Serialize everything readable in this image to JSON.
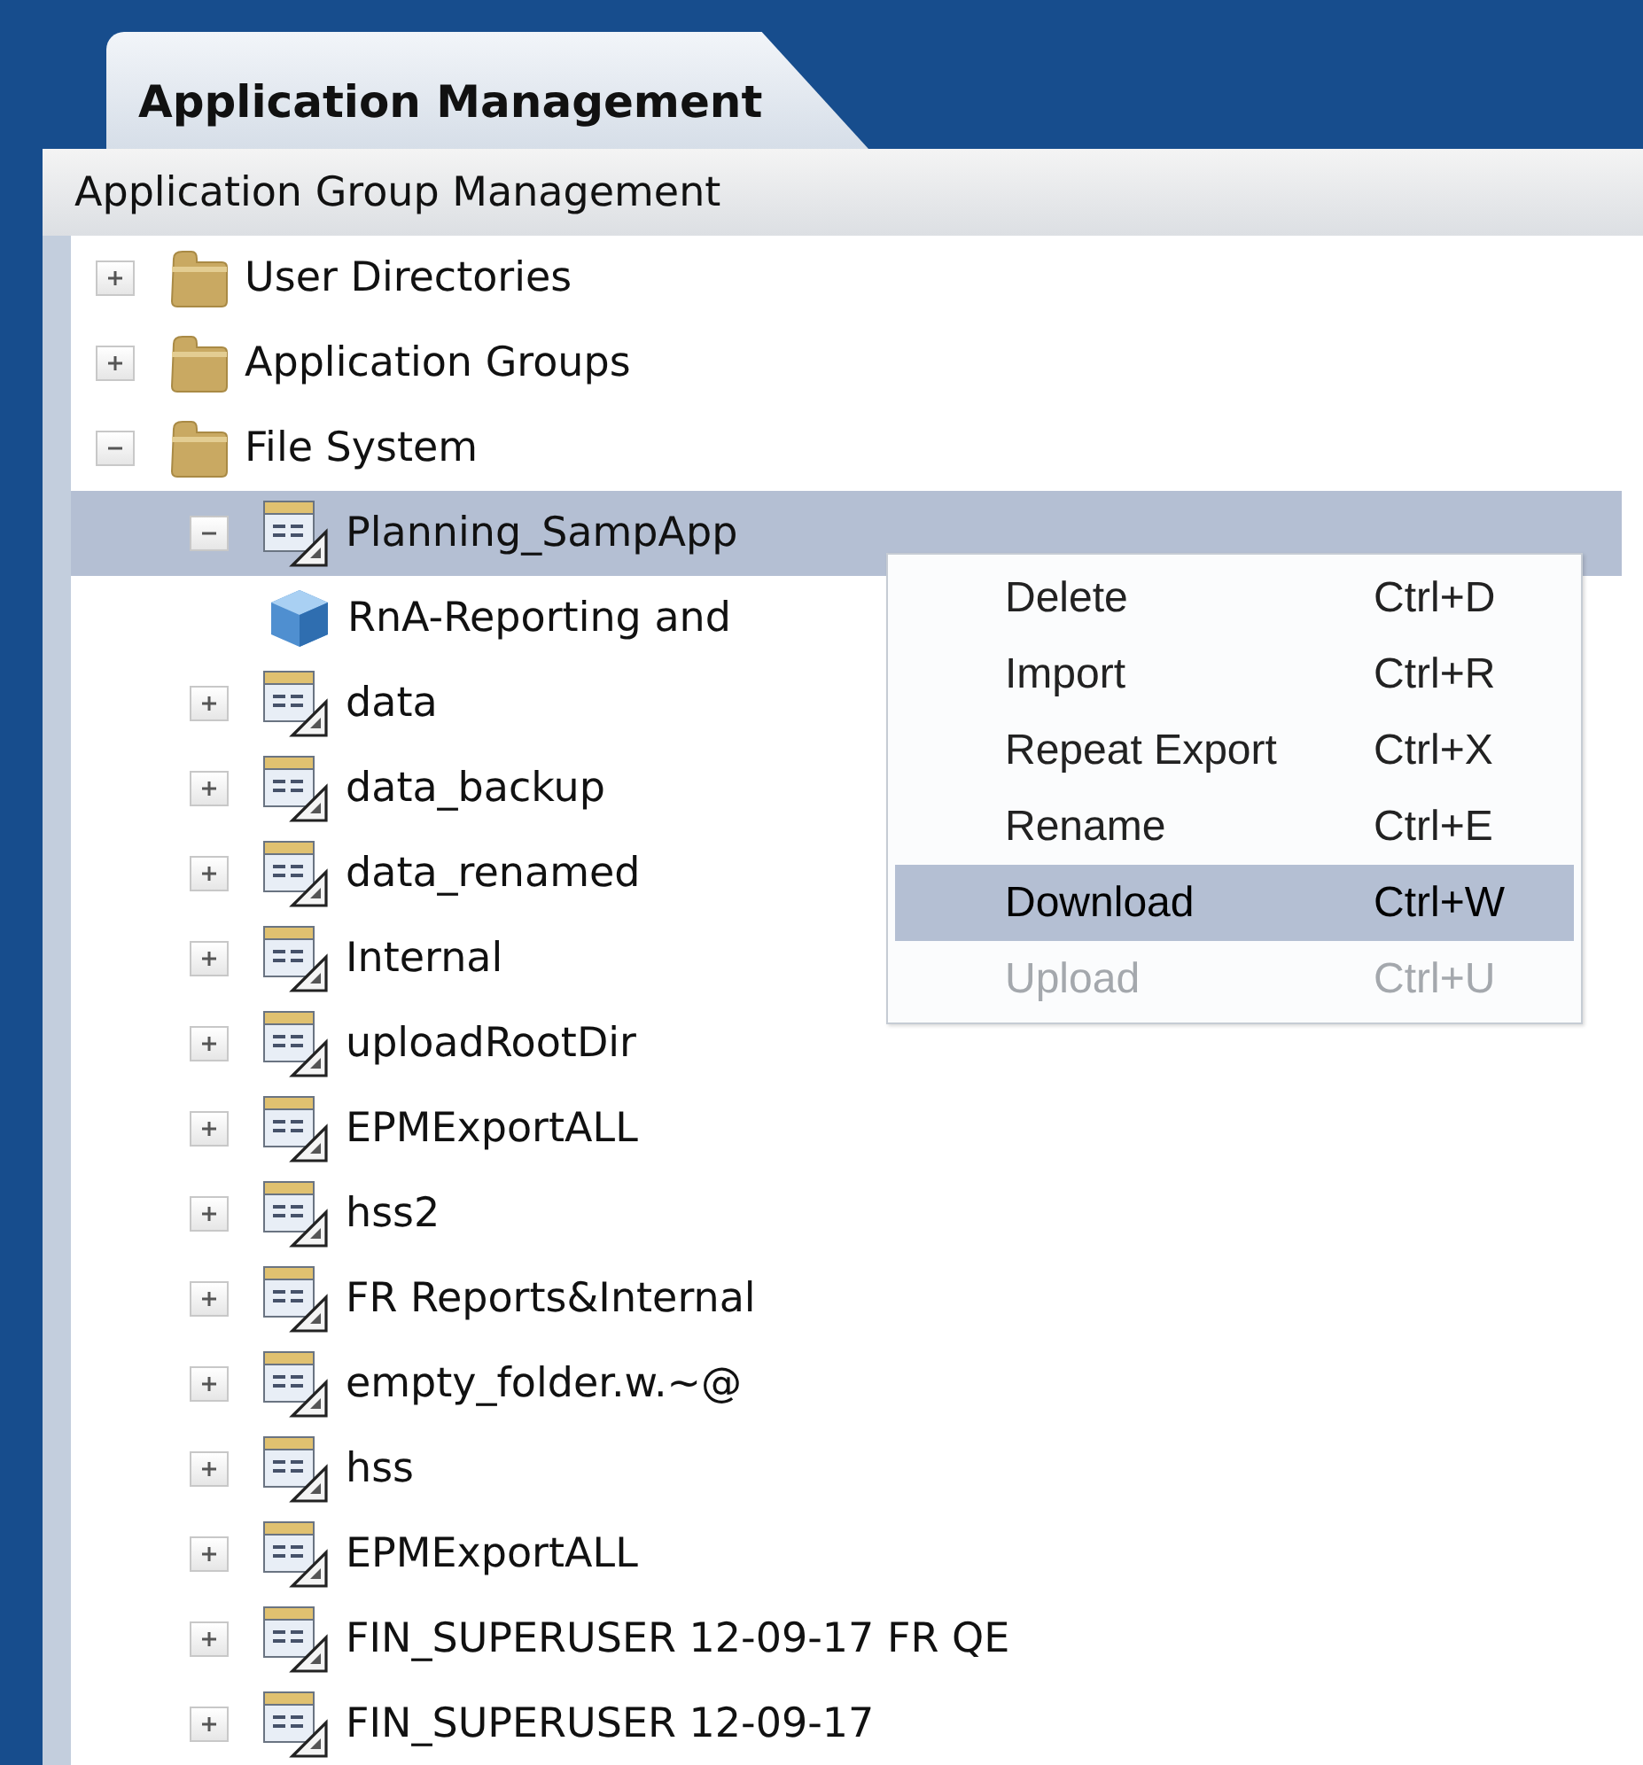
{
  "tab": {
    "label": "Application Management",
    "selected": true
  },
  "panel": {
    "title": "Application Group Management"
  },
  "tree": [
    {
      "label": "User Directories",
      "kind": "folder",
      "expanded": false,
      "selected": false
    },
    {
      "label": "Application Groups",
      "kind": "folder",
      "expanded": false,
      "selected": false
    },
    {
      "label": "File System",
      "kind": "folder",
      "expanded": true,
      "selected": false,
      "children": [
        {
          "label": "Planning_SampApp",
          "kind": "file-system",
          "expanded": true,
          "selected": true,
          "children": [
            {
              "label": "RnA-Reporting and",
              "kind": "application",
              "selected": false
            }
          ]
        },
        {
          "label": "data",
          "kind": "file-system",
          "expanded": false,
          "selected": false
        },
        {
          "label": "data_backup",
          "kind": "file-system",
          "expanded": false,
          "selected": false
        },
        {
          "label": "data_renamed",
          "kind": "file-system",
          "expanded": false,
          "selected": false
        },
        {
          "label": "Internal",
          "kind": "file-system",
          "expanded": false,
          "selected": false
        },
        {
          "label": "uploadRootDir",
          "kind": "file-system",
          "expanded": false,
          "selected": false
        },
        {
          "label": "EPMExportALL",
          "kind": "file-system",
          "expanded": false,
          "selected": false
        },
        {
          "label": "hss2",
          "kind": "file-system",
          "expanded": false,
          "selected": false
        },
        {
          "label": "FR Reports&Internal",
          "kind": "file-system",
          "expanded": false,
          "selected": false
        },
        {
          "label": "empty_folder.w.~@",
          "kind": "file-system",
          "expanded": false,
          "selected": false
        },
        {
          "label": "hss",
          "kind": "file-system",
          "expanded": false,
          "selected": false
        },
        {
          "label": "EPMExportALL",
          "kind": "file-system",
          "expanded": false,
          "selected": false
        },
        {
          "label": "FIN_SUPERUSER 12-09-17 FR QE",
          "kind": "file-system",
          "expanded": false,
          "selected": false
        },
        {
          "label": "FIN_SUPERUSER 12-09-17",
          "kind": "file-system",
          "expanded": false,
          "selected": false
        }
      ]
    }
  ],
  "context_menu": [
    {
      "label": "Delete",
      "shortcut": "Ctrl+D",
      "selected": false,
      "disabled": false
    },
    {
      "label": "Import",
      "shortcut": "Ctrl+R",
      "selected": false,
      "disabled": false
    },
    {
      "label": "Repeat Export",
      "shortcut": "Ctrl+X",
      "selected": false,
      "disabled": false
    },
    {
      "label": "Rename",
      "shortcut": "Ctrl+E",
      "selected": false,
      "disabled": false
    },
    {
      "label": "Download",
      "shortcut": "Ctrl+W",
      "selected": true,
      "disabled": false
    },
    {
      "label": "Upload",
      "shortcut": "Ctrl+U",
      "selected": false,
      "disabled": true
    }
  ]
}
